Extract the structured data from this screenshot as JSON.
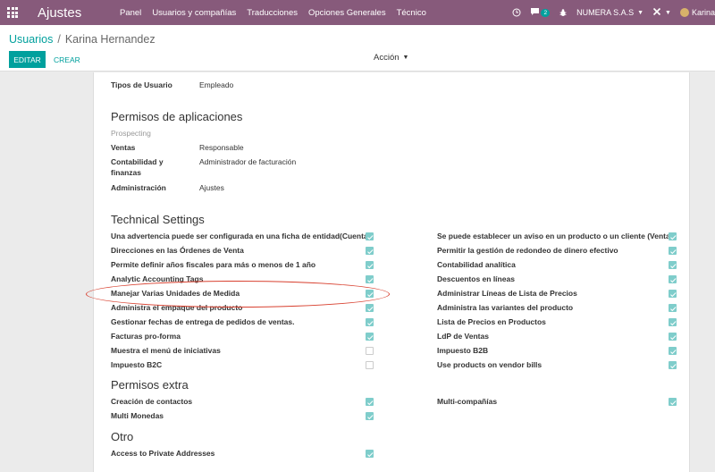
{
  "navbar": {
    "brand": "Ajustes",
    "menu": [
      "Panel",
      "Usuarios y compañías",
      "Traducciones",
      "Opciones Generales",
      "Técnico"
    ],
    "chat_badge": "2",
    "company": "NUMERA S.A.S",
    "user": "Karina",
    "icons": [
      "apps-icon",
      "clock-icon",
      "chat-icon",
      "bug-icon",
      "tools-icon"
    ]
  },
  "breadcrumb": {
    "parent": "Usuarios",
    "separator": "/",
    "current": "Karina Hernandez"
  },
  "buttons": {
    "edit": "EDITAR",
    "create": "CREAR",
    "action": "Acción"
  },
  "user_type": {
    "label": "Tipos de Usuario",
    "value": "Empleado"
  },
  "app_permissions": {
    "title": "Permisos de aplicaciones",
    "subheader": "Prospecting",
    "rows": [
      {
        "label": "Ventas",
        "value": "Responsable"
      },
      {
        "label": "Contabilidad y finanzas",
        "label_line1": "Contabilidad y",
        "label_line2": "finanzas",
        "value": "Administrador de facturación"
      },
      {
        "label": "Administración",
        "value": "Ajustes"
      }
    ]
  },
  "technical": {
    "title": "Technical Settings",
    "left": [
      {
        "label": "Una advertencia puede ser configurada en una ficha de entidad(Cuenta)",
        "checked": true
      },
      {
        "label": "Direcciones en las Órdenes de Venta",
        "checked": true
      },
      {
        "label": "Permite definir años fiscales para más o menos de 1 año",
        "checked": true
      },
      {
        "label": "Analytic Accounting Tags",
        "checked": true
      },
      {
        "label": "Manejar Varias Unidades de Medida",
        "checked": true
      },
      {
        "label": "Administra el empaque del producto",
        "checked": true
      },
      {
        "label": "Gestionar fechas de entrega de pedidos de ventas.",
        "checked": true
      },
      {
        "label": "Facturas pro-forma",
        "checked": true
      },
      {
        "label": "Muestra el menú de iniciativas",
        "checked": false
      },
      {
        "label": "Impuesto B2C",
        "checked": false
      }
    ],
    "right": [
      {
        "label": "Se puede establecer un aviso en un producto o un cliente (Venta)",
        "checked": true
      },
      {
        "label": "Permitir la gestión de redondeo de dinero efectivo",
        "checked": true
      },
      {
        "label": "Contabilidad analítica",
        "checked": true
      },
      {
        "label": "Descuentos en líneas",
        "checked": true
      },
      {
        "label": "Administrar Líneas de Lista de Precios",
        "checked": true
      },
      {
        "label": "Administra las variantes del producto",
        "checked": true
      },
      {
        "label": "Lista de Precios en Productos",
        "checked": true
      },
      {
        "label": "LdP de Ventas",
        "checked": true
      },
      {
        "label": "Impuesto B2B",
        "checked": true
      },
      {
        "label": "Use products on vendor bills",
        "checked": true
      }
    ]
  },
  "extra": {
    "title": "Permisos extra",
    "left": [
      {
        "label": "Creación de contactos",
        "checked": true
      },
      {
        "label": "Multi Monedas",
        "checked": true
      }
    ],
    "right": [
      {
        "label": "Multi-compañías",
        "checked": true
      }
    ]
  },
  "other": {
    "title": "Otro",
    "rows": [
      {
        "label": "Access to Private Addresses",
        "checked": true
      }
    ]
  },
  "colors": {
    "navbar": "#875a7b",
    "accent": "#00a09d",
    "checkbox": "#7fcdcb",
    "highlight": "#d8402f"
  }
}
